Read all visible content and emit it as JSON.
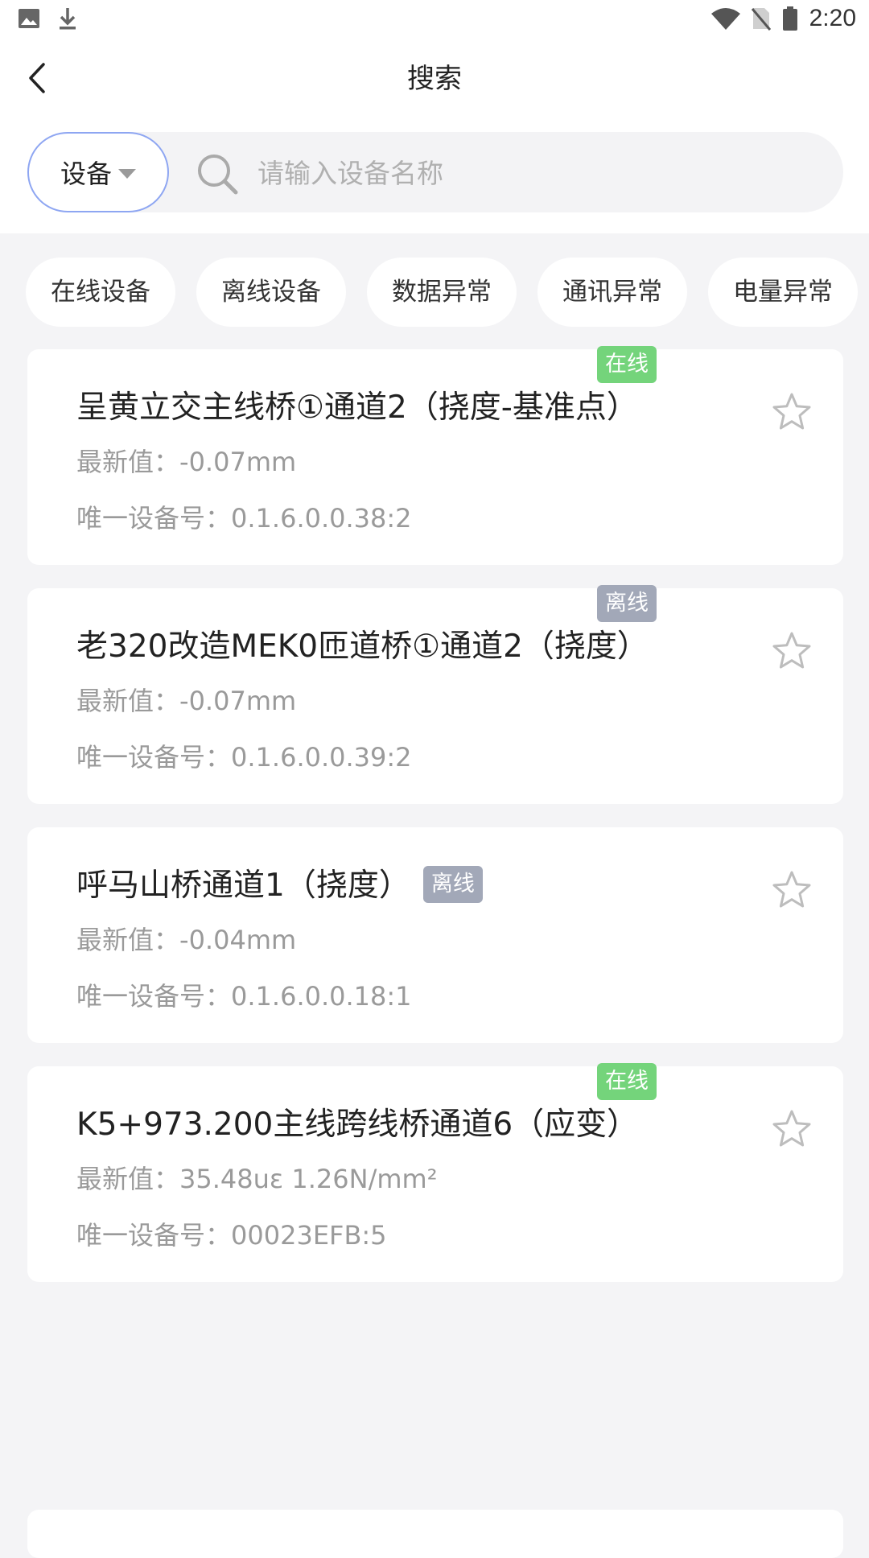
{
  "status_bar": {
    "time": "2:20",
    "icons": [
      "image-icon",
      "download-icon",
      "wifi-icon",
      "no-sim-icon",
      "battery-icon"
    ]
  },
  "header": {
    "title": "搜索",
    "back_icon": "chevron-left-icon"
  },
  "search": {
    "type_label": "设备",
    "placeholder": "请输入设备名称",
    "value": ""
  },
  "filters": [
    "在线设备",
    "离线设备",
    "数据异常",
    "通讯异常",
    "电量异常"
  ],
  "colors": {
    "online": "#74d47b",
    "offline": "#a2a8b8",
    "pill_border": "#8ea6f2",
    "page_bg": "#f4f4f6"
  },
  "devices": [
    {
      "name": "呈黄立交主线桥①通道2（挠度-基准点）",
      "status": "在线",
      "latest_label": "最新值：",
      "latest_value": "-0.07mm",
      "uid_label": "唯一设备号：",
      "uid": "0.1.6.0.0.38:2"
    },
    {
      "name": "老320改造MEK0匝道桥①通道2（挠度）",
      "status": "离线",
      "latest_label": "最新值：",
      "latest_value": "-0.07mm",
      "uid_label": "唯一设备号：",
      "uid": "0.1.6.0.0.39:2"
    },
    {
      "name": "呼马山桥通道1（挠度）",
      "status": "离线",
      "latest_label": "最新值：",
      "latest_value": "-0.04mm",
      "uid_label": "唯一设备号：",
      "uid": "0.1.6.0.0.18:1"
    },
    {
      "name": "K5+973.200主线跨线桥通道6（应变）",
      "status": "在线",
      "latest_label": "最新值：",
      "latest_value": "35.48uε 1.26N/mm²",
      "uid_label": "唯一设备号：",
      "uid": "00023EFB:5"
    }
  ]
}
